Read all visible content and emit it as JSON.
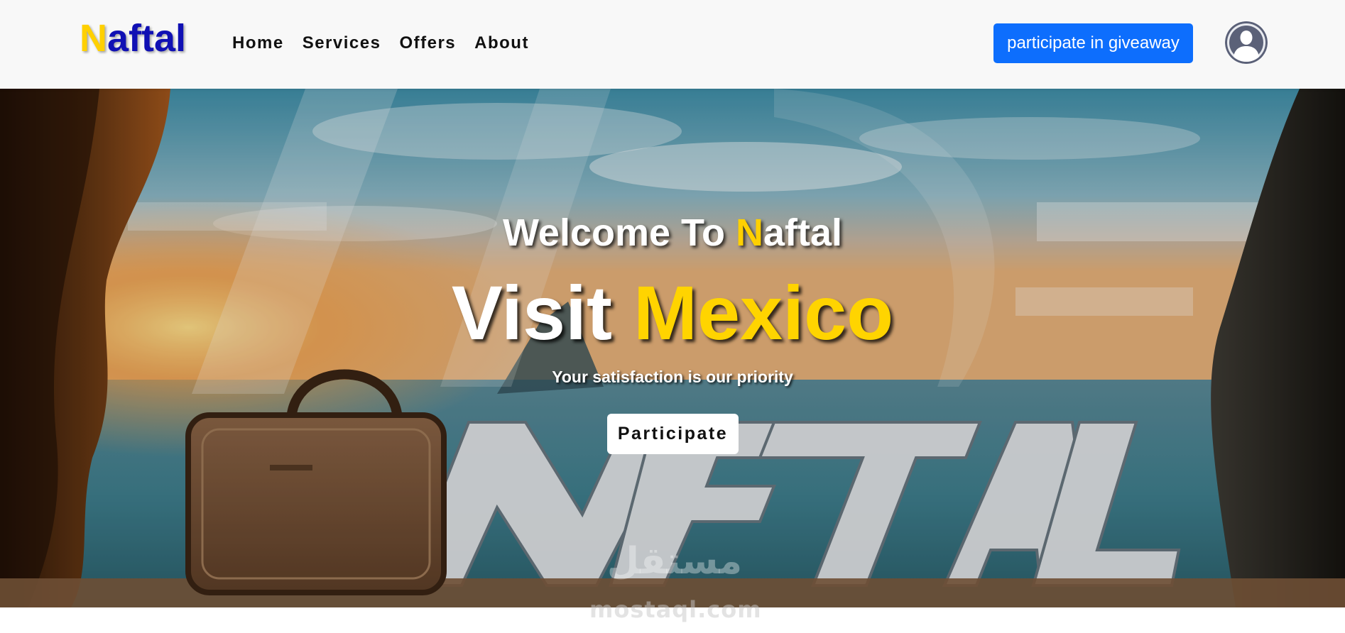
{
  "header": {
    "logo_first": "N",
    "logo_rest": "aftal",
    "nav": [
      {
        "label": "Home"
      },
      {
        "label": "Services"
      },
      {
        "label": "Offers"
      },
      {
        "label": "About"
      }
    ],
    "giveaway_button": "participate in giveaway",
    "avatar_icon": "user-avatar-icon"
  },
  "hero": {
    "welcome_prefix": "Welcome To ",
    "welcome_accent": "N",
    "welcome_suffix": "aftal",
    "visit_word": "Visit",
    "destination": "Mexico",
    "tagline": "Your satisfaction is our priority",
    "cta_button": "Participate",
    "background_text": "NAFTAL"
  },
  "watermark": {
    "arabic": "مستقل",
    "latin": "mostaql.com"
  },
  "colors": {
    "brand_blue": "#1010b4",
    "brand_yellow": "#ffd000",
    "button_blue": "#0d6efd",
    "header_bg": "#f8f8f8"
  }
}
